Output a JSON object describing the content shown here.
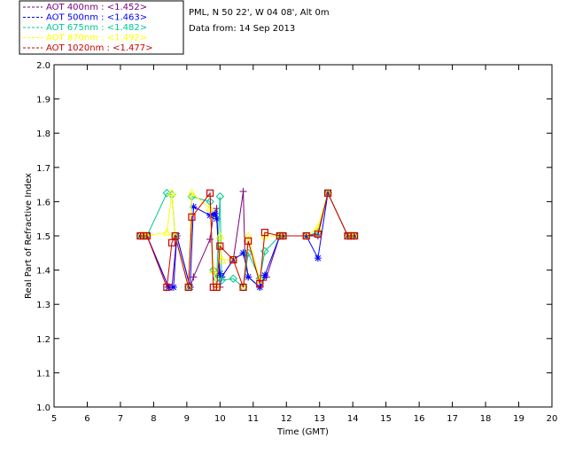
{
  "chart_data": {
    "type": "line",
    "header_lines": [
      "PML, N 50 22', W 04 08', Alt 0m",
      "Data from: 14 Sep 2013"
    ],
    "xlabel": "Time (GMT)",
    "ylabel": "Real Part of Refractive Index",
    "xlim": [
      5,
      20
    ],
    "ylim": [
      1.0,
      2.0
    ],
    "xticks": [
      5,
      6,
      7,
      8,
      9,
      10,
      11,
      12,
      13,
      14,
      15,
      16,
      17,
      18,
      19,
      20
    ],
    "yticks": [
      1.0,
      1.1,
      1.2,
      1.3,
      1.4,
      1.5,
      1.6,
      1.7,
      1.8,
      1.9,
      2.0
    ],
    "ytick_labels": [
      "1.0",
      "1.1",
      "1.2",
      "1.3",
      "1.4",
      "1.5",
      "1.6",
      "1.7",
      "1.8",
      "1.9",
      "2.0"
    ],
    "grid": false,
    "legend_position": "top-left",
    "series": [
      {
        "name": "AOT  400nm : <1.452>",
        "color": "#7a007a",
        "marker": "plus",
        "x": [
          7.6,
          7.7,
          7.8,
          8.45,
          8.55,
          8.7,
          9.1,
          9.2,
          9.7,
          9.8,
          9.9,
          10.0,
          10.05,
          10.4,
          10.7,
          10.75,
          10.85,
          11.2,
          11.3,
          11.4,
          11.8,
          11.9,
          12.6,
          12.95,
          13.25,
          13.85,
          13.95,
          14.05
        ],
        "y": [
          1.5,
          1.5,
          1.5,
          1.35,
          1.35,
          1.5,
          1.35,
          1.38,
          1.49,
          1.56,
          1.58,
          1.35,
          1.38,
          1.43,
          1.63,
          1.45,
          1.38,
          1.35,
          1.37,
          1.38,
          1.5,
          1.5,
          1.5,
          1.5,
          1.625,
          1.5,
          1.5,
          1.5
        ]
      },
      {
        "name": "AOT  500nm : <1.463>",
        "color": "#0000ff",
        "marker": "asterisk",
        "x": [
          7.6,
          7.7,
          7.8,
          8.45,
          8.6,
          8.7,
          9.1,
          9.2,
          9.7,
          9.85,
          9.9,
          10.0,
          10.05,
          10.4,
          10.7,
          10.85,
          11.2,
          11.35,
          11.8,
          11.9,
          12.6,
          12.95,
          13.25,
          13.85,
          13.95,
          14.05
        ],
        "y": [
          1.5,
          1.5,
          1.5,
          1.35,
          1.35,
          1.5,
          1.35,
          1.585,
          1.56,
          1.565,
          1.55,
          1.39,
          1.38,
          1.43,
          1.45,
          1.38,
          1.35,
          1.385,
          1.5,
          1.5,
          1.5,
          1.435,
          1.625,
          1.5,
          1.5,
          1.5
        ]
      },
      {
        "name": "AOT  675nm : <1.482>",
        "color": "#00c890",
        "marker": "diamond",
        "x": [
          7.6,
          7.7,
          7.8,
          8.4,
          8.55,
          8.65,
          9.05,
          9.15,
          9.7,
          9.8,
          9.9,
          10.0,
          10.05,
          10.4,
          10.7,
          10.85,
          11.2,
          11.35,
          11.8,
          11.9,
          12.6,
          12.95,
          13.25,
          13.85,
          13.95,
          14.05
        ],
        "y": [
          1.5,
          1.5,
          1.5,
          1.625,
          1.62,
          1.5,
          1.35,
          1.615,
          1.6,
          1.4,
          1.375,
          1.615,
          1.37,
          1.375,
          1.35,
          1.45,
          1.375,
          1.455,
          1.5,
          1.5,
          1.5,
          1.51,
          1.625,
          1.5,
          1.5,
          1.5
        ]
      },
      {
        "name": "AOT  870nm : <1.492>",
        "color": "#ffff00",
        "marker": "triangle",
        "x": [
          7.6,
          7.7,
          7.8,
          8.4,
          8.55,
          8.65,
          9.05,
          9.15,
          9.7,
          9.8,
          9.9,
          10.0,
          10.05,
          10.4,
          10.7,
          10.85,
          11.2,
          11.35,
          11.8,
          11.9,
          12.6,
          12.95,
          13.25,
          13.85,
          13.95,
          14.05
        ],
        "y": [
          1.5,
          1.5,
          1.5,
          1.51,
          1.625,
          1.5,
          1.35,
          1.625,
          1.58,
          1.4,
          1.35,
          1.5,
          1.43,
          1.43,
          1.35,
          1.5,
          1.37,
          1.5,
          1.5,
          1.5,
          1.5,
          1.525,
          1.625,
          1.5,
          1.5,
          1.5
        ]
      },
      {
        "name": "AOT 1020nm : <1.477>",
        "color": "#cc0000",
        "marker": "square",
        "x": [
          7.6,
          7.7,
          7.8,
          8.4,
          8.55,
          8.65,
          9.05,
          9.15,
          9.7,
          9.8,
          9.9,
          10.0,
          10.4,
          10.7,
          10.85,
          11.2,
          11.35,
          11.8,
          11.9,
          12.6,
          12.95,
          13.25,
          13.85,
          13.95,
          14.05
        ],
        "y": [
          1.5,
          1.5,
          1.5,
          1.35,
          1.48,
          1.5,
          1.35,
          1.555,
          1.625,
          1.35,
          1.35,
          1.47,
          1.43,
          1.35,
          1.485,
          1.36,
          1.51,
          1.5,
          1.5,
          1.5,
          1.505,
          1.625,
          1.5,
          1.5,
          1.5
        ]
      }
    ]
  }
}
